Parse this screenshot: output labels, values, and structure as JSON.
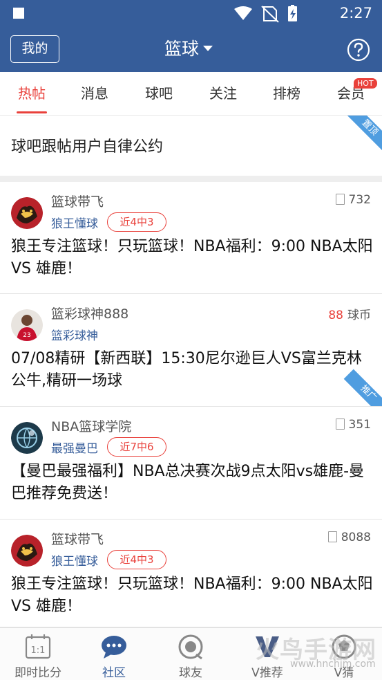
{
  "statusbar": {
    "time": "2:27"
  },
  "header": {
    "my_label": "我的",
    "title": "篮球"
  },
  "tabs": [
    {
      "label": "热帖"
    },
    {
      "label": "消息"
    },
    {
      "label": "球吧"
    },
    {
      "label": "关注"
    },
    {
      "label": "排榜"
    },
    {
      "label": "会员"
    }
  ],
  "tab_badge": "HOT",
  "pinned": {
    "text": "球吧跟帖用户自律公约",
    "ribbon": "置顶"
  },
  "posts": [
    {
      "user": "篮球带飞",
      "tag": "狼王懂球",
      "record": "近4中3",
      "stat": "732",
      "title": "狼王专注篮球！只玩篮球！NBA福利：9:00 NBA太阳 VS 雄鹿！"
    },
    {
      "user": "篮彩球神888",
      "tag": "篮彩球神",
      "coins": "88",
      "coin_unit": "球币",
      "title": "07/08精研【新西联】15:30尼尔逊巨人VS富兰克林公牛,精研一场球",
      "ribbon": "推广"
    },
    {
      "user": "NBA篮球学院",
      "tag": "最强曼巴",
      "record": "近7中6",
      "stat": "351",
      "title": "【曼巴最强福利】NBA总决赛次战9点太阳vs雄鹿-曼巴推荐免费送！"
    },
    {
      "user": "篮球带飞",
      "tag": "狼王懂球",
      "record": "近4中3",
      "stat": "8088",
      "title": "狼王专注篮球！只玩篮球！NBA福利：9:00 NBA太阳 VS 雄鹿！"
    }
  ],
  "bottomnav": [
    {
      "label": "即时比分",
      "icon": "calendar-score-icon"
    },
    {
      "label": "社区",
      "icon": "chat-bubble-icon"
    },
    {
      "label": "球友",
      "icon": "ball-icon"
    },
    {
      "label": "V推荐",
      "icon": "v-icon"
    },
    {
      "label": "V猜",
      "icon": "guess-ball-icon"
    }
  ],
  "nav_score_icon_text": "1:1",
  "watermark": {
    "text": "火鸟手游网",
    "url": "www.hnchjm.com"
  },
  "colors": {
    "brand_blue": "#365d9a",
    "accent_red": "#e9413b",
    "ribbon_blue": "#4f9de0"
  }
}
